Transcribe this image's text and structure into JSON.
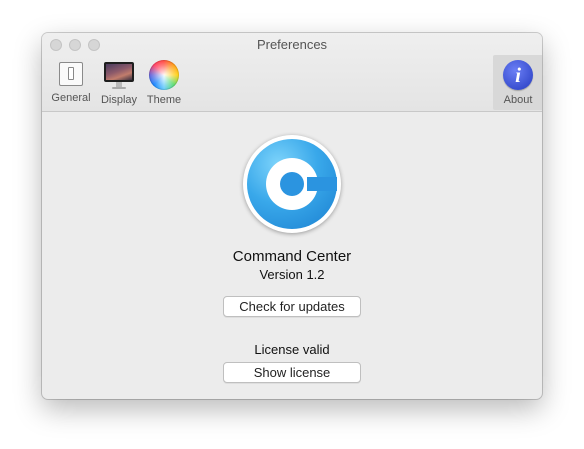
{
  "window": {
    "title": "Preferences"
  },
  "toolbar": {
    "items": [
      {
        "label": "General",
        "icon": "general-switch-icon"
      },
      {
        "label": "Display",
        "icon": "display-monitor-icon"
      },
      {
        "label": "Theme",
        "icon": "color-wheel-icon"
      },
      {
        "label": "About",
        "icon": "info-icon",
        "selected": true
      }
    ],
    "about_glyph": "i"
  },
  "about": {
    "app_icon": "command-center-logo-icon",
    "app_name": "Command Center",
    "version": "Version 1.2",
    "check_updates_label": "Check for updates",
    "license_status": "License valid",
    "show_license_label": "Show license"
  },
  "colors": {
    "window_bg": "#ececec",
    "accent_blue": "#2b94e0",
    "about_icon_blue": "#3a4fd0"
  }
}
